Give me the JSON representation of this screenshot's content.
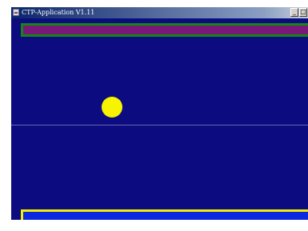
{
  "window": {
    "title": "CTP-Application V1.11",
    "controls": {
      "minimize_glyph": "_",
      "maximize_glyph": "□"
    }
  },
  "game": {
    "colors": {
      "field": "#0c0c80",
      "center_line": "#6666b8",
      "ball": "#f8f400",
      "top_paddle_fill": "#7a187a",
      "top_paddle_border": "#118811",
      "bottom_paddle_fill": "#0c28e0",
      "bottom_paddle_border": "#f2f000"
    }
  }
}
